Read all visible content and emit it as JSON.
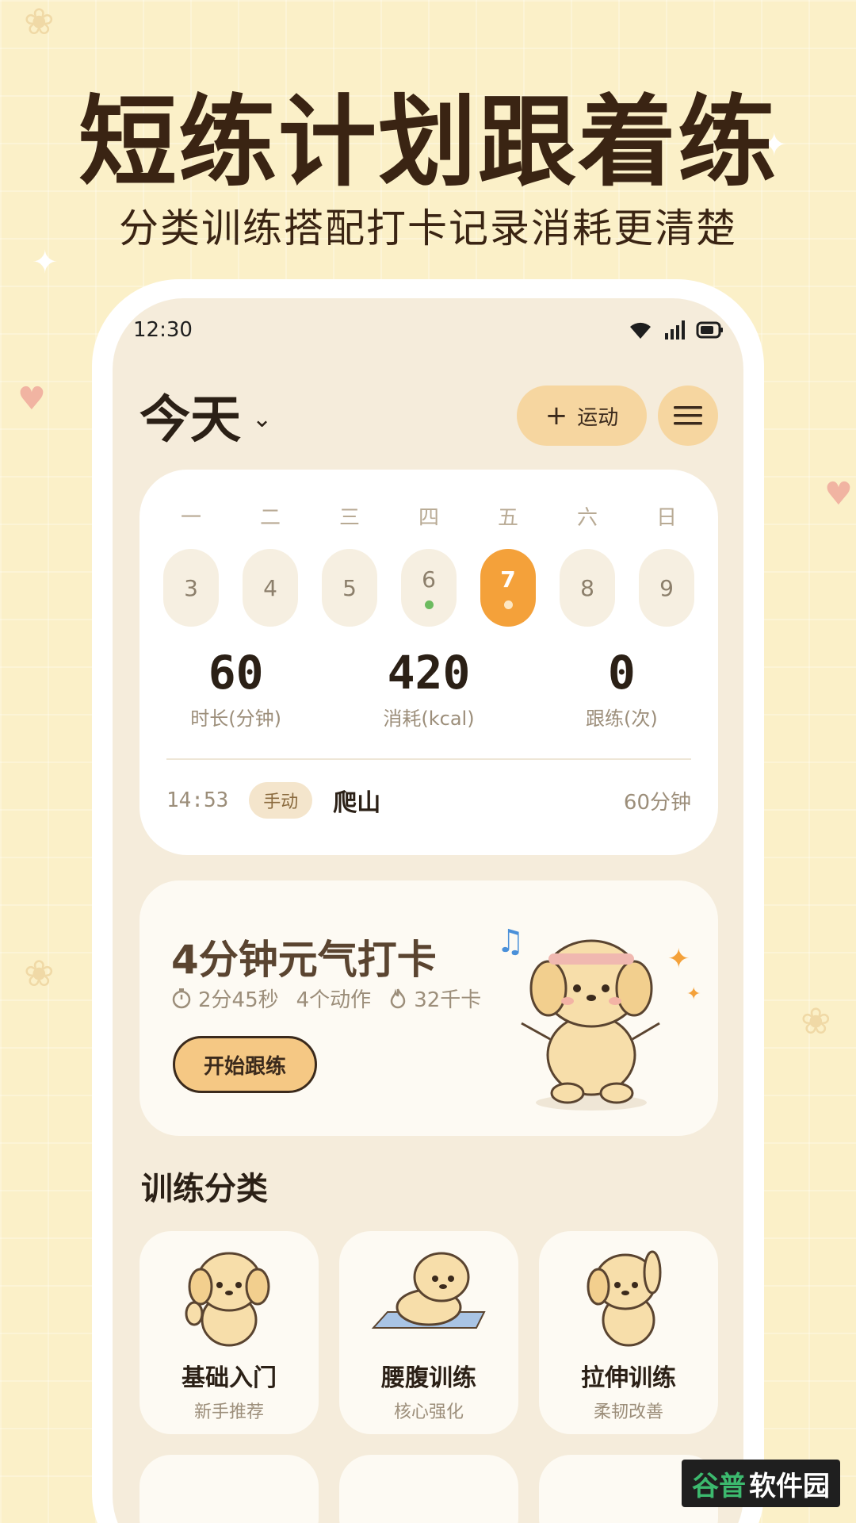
{
  "hero": {
    "title": "短练计划跟着练",
    "subtitle": "分类训练搭配打卡记录消耗更清楚"
  },
  "status_bar": {
    "time": "12:30",
    "icons": [
      "wifi-icon",
      "signal-icon",
      "battery-icon"
    ]
  },
  "header": {
    "day_label": "今天",
    "add_label": "运动"
  },
  "week": {
    "weekdays": [
      "一",
      "二",
      "三",
      "四",
      "五",
      "六",
      "日"
    ],
    "dates": [
      {
        "day": "3",
        "dot": null
      },
      {
        "day": "4",
        "dot": null
      },
      {
        "day": "5",
        "dot": null
      },
      {
        "day": "6",
        "dot": "green"
      },
      {
        "day": "7",
        "dot": "white",
        "selected": true
      },
      {
        "day": "8",
        "dot": null
      },
      {
        "day": "9",
        "dot": null
      }
    ]
  },
  "stats": [
    {
      "value": "60",
      "label": "时长(分钟)"
    },
    {
      "value": "420",
      "label": "消耗(kcal)"
    },
    {
      "value": "0",
      "label": "跟练(次)"
    }
  ],
  "record": {
    "time": "14:53",
    "badge": "手动",
    "name": "爬山",
    "duration": "60分钟"
  },
  "promo": {
    "title": "4分钟元气打卡",
    "duration": "2分45秒",
    "moves": "4个动作",
    "calories": "32千卡",
    "button": "开始跟练"
  },
  "categories_title": "训练分类",
  "categories": [
    {
      "name": "基础入门",
      "desc": "新手推荐"
    },
    {
      "name": "腰腹训练",
      "desc": "核心强化"
    },
    {
      "name": "拉伸训练",
      "desc": "柔韧改善"
    }
  ],
  "watermark": {
    "part1": "谷普",
    "part2": "软件园"
  },
  "colors": {
    "accent": "#f4a13a",
    "button_bg": "#f6d6a0",
    "background": "#fbf0c8",
    "screen": "#f5ecdb"
  }
}
